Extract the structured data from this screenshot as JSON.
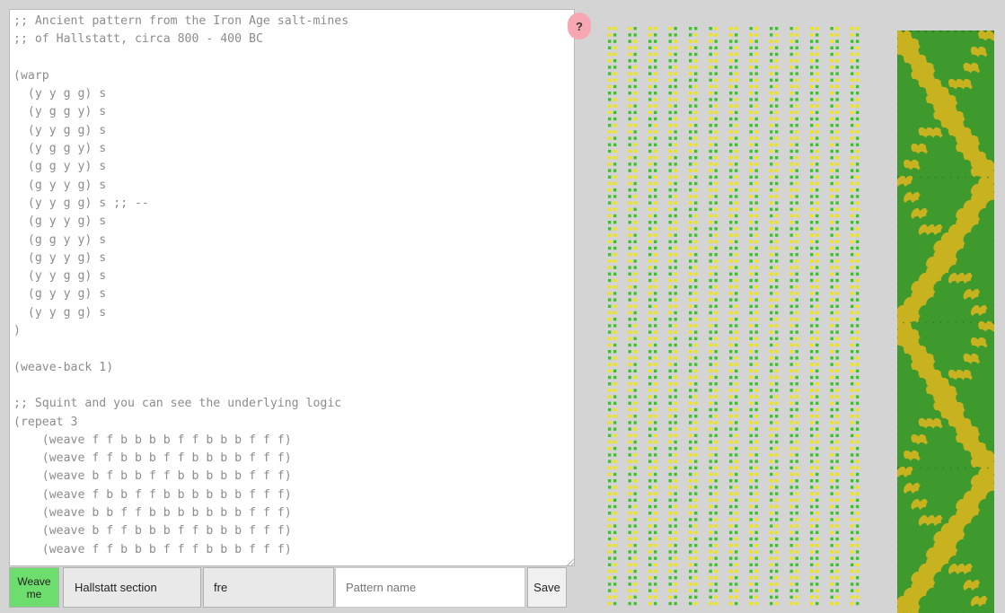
{
  "editor": {
    "lines": [
      ";; Ancient pattern from the Iron Age salt-mines",
      ";; of Hallstatt, circa 800 - 400 BC",
      "",
      "(warp",
      "  (y y g g) s",
      "  (y g g y) s",
      "  (y y g g) s",
      "  (y g g y) s",
      "  (g g y y) s",
      "  (g y y g) s",
      "  (y y g g) s ;; --",
      "  (g y y g) s",
      "  (g g y y) s",
      "  (g y y g) s",
      "  (y y g g) s",
      "  (g y y g) s",
      "  (y y g g) s",
      ")",
      "",
      "(weave-back 1)",
      "",
      ";; Squint and you can see the underlying logic",
      "(repeat 3",
      "    (weave f f b b b b f f b b b f f f)",
      "    (weave f f b b b f f b b b b f f f)",
      "    (weave b f b b f f b b b b b f f f)",
      "    (weave f b b f f b b b b b b f f f)",
      "    (weave b b f f b b b b b b b f f f)",
      "    (weave b f f b b b f f b b b f f f)",
      "    (weave f f b b b f f f b b b f f f)"
    ]
  },
  "help": {
    "label": "?"
  },
  "controls": {
    "weave_label": "Weave me",
    "pattern_selected": "Hallstatt section",
    "load_value": "fre",
    "name_placeholder": "Pattern name",
    "save_label": "Save"
  },
  "colors": {
    "yellow": "#f2e600",
    "green": "#3bc22b",
    "band_yellow": "#c8b21f",
    "band_green": "#3f9a2e",
    "band_dark": "#2c7b23"
  },
  "warp": [
    [
      "y",
      "y",
      "g",
      "g"
    ],
    [
      "y",
      "g",
      "g",
      "y"
    ],
    [
      "y",
      "y",
      "g",
      "g"
    ],
    [
      "y",
      "g",
      "g",
      "y"
    ],
    [
      "g",
      "g",
      "y",
      "y"
    ],
    [
      "g",
      "y",
      "y",
      "g"
    ],
    [
      "y",
      "y",
      "g",
      "g"
    ],
    [
      "g",
      "y",
      "y",
      "g"
    ],
    [
      "g",
      "g",
      "y",
      "y"
    ],
    [
      "g",
      "y",
      "y",
      "g"
    ],
    [
      "y",
      "y",
      "g",
      "g"
    ],
    [
      "g",
      "y",
      "y",
      "g"
    ],
    [
      "y",
      "y",
      "g",
      "g"
    ]
  ]
}
